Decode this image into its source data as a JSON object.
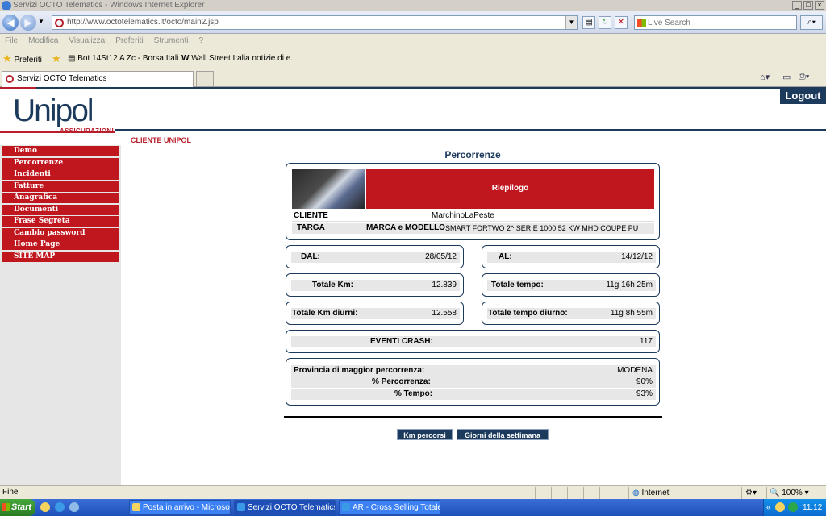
{
  "window": {
    "title": "Servizi OCTO Telematics - Windows Internet Explorer",
    "url": "http://www.octotelematics.it/octo/main2.jsp",
    "search_placeholder": "Live Search",
    "menu": [
      "File",
      "Modifica",
      "Visualizza",
      "Preferiti",
      "Strumenti",
      "?"
    ],
    "favorites_label": "Preferiti",
    "favorites": [
      "Bot 14St12 A Zc - Borsa Itali...",
      "Wall Street Italia notizie di e..."
    ],
    "tab_title": "Servizi OCTO Telematics"
  },
  "page": {
    "logout": "Logout",
    "logo_name": "Unipol",
    "logo_sub": "ASSICURAZIONI",
    "breadcrumb": "CLIENTE UNIPOL",
    "menu": [
      "Demo",
      "Percorrenze",
      "Incidenti",
      "Fatture",
      "Anagrafica",
      "Documenti",
      "Frase Segreta",
      "Cambio password",
      "Home Page",
      "SITE MAP"
    ],
    "title": "Percorrenze",
    "summary": {
      "heading": "Riepilogo",
      "cliente_label": "CLIENTE",
      "cliente_value": "MarchinoLaPeste",
      "targa_label": "TARGA",
      "marca_label": "MARCA e MODELLO",
      "marca_value": "SMART FORTWO 2^ SERIE 1000 52 KW MHD COUPE PU"
    },
    "dal_label": "DAL:",
    "dal_value": "28/05/12",
    "al_label": "AL:",
    "al_value": "14/12/12",
    "km_label": "Totale Km:",
    "km_value": "12.839",
    "tempo_label": "Totale tempo:",
    "tempo_value": "11g 16h 25m",
    "km_diurni_label": "Totale Km diurni:",
    "km_diurni_value": "12.558",
    "tempo_diurno_label": "Totale tempo diurno:",
    "tempo_diurno_value": "11g 8h 55m",
    "crash_label": "EVENTI CRASH:",
    "crash_value": "117",
    "provincia_label": "Provincia di maggior percorrenza:",
    "provincia_value": "MODENA",
    "perc_label": "% Percorrenza:",
    "perc_value": "90%",
    "ptempo_label": "% Tempo:",
    "ptempo_value": "93%",
    "btn_km": "Km percorsi",
    "btn_giorni": "Giorni della settimana"
  },
  "status": {
    "text": "Fine",
    "zone": "Internet",
    "zoom": "100%"
  },
  "taskbar": {
    "start": "Start",
    "tasks": [
      "Posta in arrivo - Microsof...",
      "Servizi OCTO Telematics ...",
      "AR - Cross Selling Totale ..."
    ],
    "clock": "11.12"
  },
  "colors": {
    "brand_red": "#c0171f",
    "brand_navy": "#1b3a5c"
  }
}
